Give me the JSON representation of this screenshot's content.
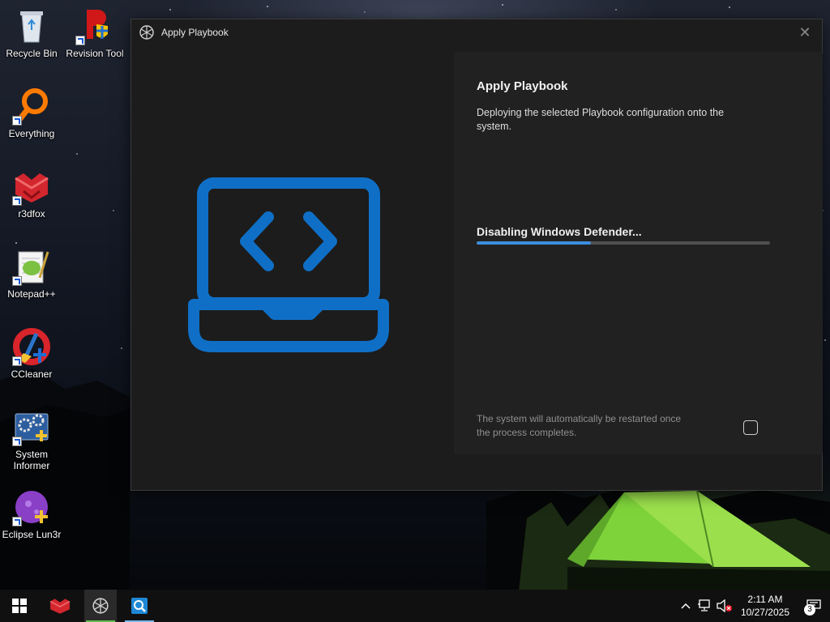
{
  "desktop": {
    "icons": [
      {
        "label": "Recycle Bin",
        "icon": "recycle-bin-icon"
      },
      {
        "label": "Revision Tool",
        "icon": "revision-tool-icon"
      },
      {
        "label": "Everything",
        "icon": "everything-search-icon"
      },
      {
        "label": "r3dfox",
        "icon": "r3dfox-browser-icon"
      },
      {
        "label": "Notepad++",
        "icon": "notepad-plus-plus-icon"
      },
      {
        "label": "CCleaner",
        "icon": "ccleaner-icon"
      },
      {
        "label": "System Informer",
        "icon": "system-informer-icon"
      },
      {
        "label": "Eclipse Lun3r",
        "icon": "eclipse-lun3r-icon"
      }
    ]
  },
  "window": {
    "title": "Apply Playbook",
    "close_glyph": "✕",
    "panel": {
      "title": "Apply Playbook",
      "description": "Deploying the selected Playbook configuration onto the system.",
      "status": "Disabling Windows Defender...",
      "progress_fraction": 0.39,
      "restart_note": "The system will automatically be restarted once the process completes.",
      "restart_checked": false
    },
    "illustration": "laptop-code-icon"
  },
  "taskbar": {
    "items": [
      "start-icon",
      "r3dfox-taskbar-icon",
      "playbook-taskbar-icon",
      "search-app-taskbar-icon"
    ],
    "tray": {
      "time": "2:11 AM",
      "date": "10/27/2025",
      "notification_count": "3"
    }
  },
  "colors": {
    "accent": "#3b8ede",
    "illustration": "#0f6fc6",
    "window_bg": "#1c1c1c",
    "panel_bg": "#212121"
  }
}
